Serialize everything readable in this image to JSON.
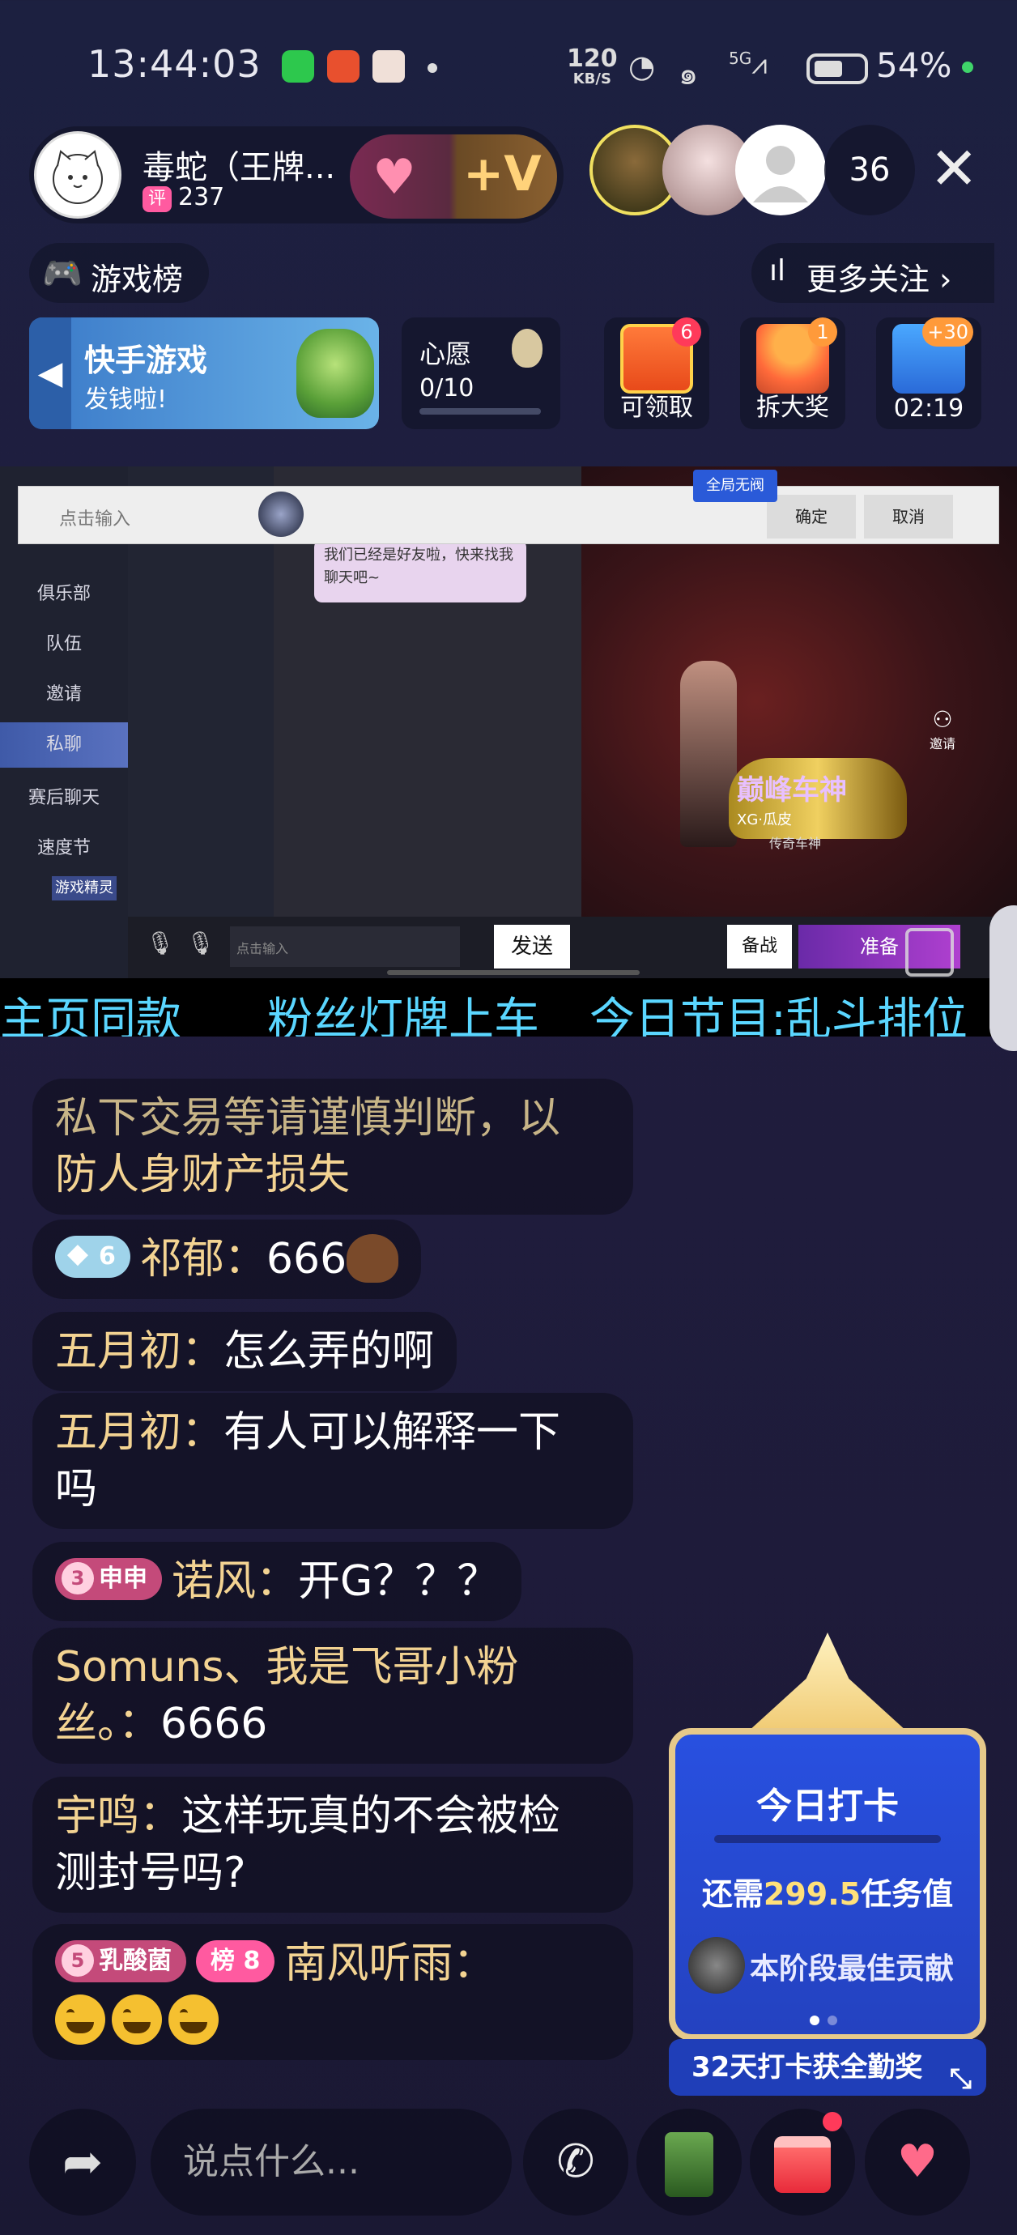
{
  "status_bar": {
    "time": "13:44:03",
    "net_speed_top": "120",
    "net_speed_bottom": "KB/S",
    "signal_label": "5G",
    "battery": "54%"
  },
  "host": {
    "name": "毒蛇（王牌...",
    "tag": "评",
    "score": "237",
    "viewer_count": "36"
  },
  "nav": {
    "game_rank": "游戏榜",
    "more_follow": "更多关注"
  },
  "activity": {
    "banner_title": "快手游戏",
    "banner_sub": "发钱啦!",
    "wish_label": "心愿",
    "wish_count": "0/10",
    "boxes": [
      {
        "label": "可领取",
        "badge": "6"
      },
      {
        "label": "拆大奖",
        "badge": "1"
      },
      {
        "label": "02:19",
        "badge": "+30"
      }
    ]
  },
  "stream": {
    "topbar_placeholder": "点击输入",
    "confirm": "确定",
    "cancel": "取消",
    "global_badge": "全局无阀",
    "sidebar": [
      "俱乐部",
      "队伍",
      "邀请",
      "私聊",
      "赛后聊天",
      "速度节"
    ],
    "sidebar_pill": "游戏精灵",
    "bubble": "我们已经是好友啦，快来找我聊天吧~",
    "game_title": "巅峰车神",
    "player": "XG·瓜皮",
    "player_sub": "传奇车神",
    "invite": "邀请",
    "chat_placeholder": "点击输入",
    "send": "发送",
    "prep": "备战",
    "ready": "准备"
  },
  "ticker": [
    "主页同款",
    "粉丝灯牌上车",
    "今日节目:乱斗排位"
  ],
  "chat": {
    "system": {
      "line1": "私下交易等请谨慎判断，以",
      "line2": "防人身财产损失"
    },
    "messages": [
      {
        "badge": "6",
        "user": "祁郁",
        "text": "666"
      },
      {
        "user": "五月初",
        "text": "怎么弄的啊"
      },
      {
        "user": "五月初",
        "text_l1": "有人可以解释一下",
        "text_l2": "吗"
      },
      {
        "badge_num": "3",
        "badge_name": "申申",
        "user": "诺风",
        "text": "开G？？？"
      },
      {
        "user_l1": "Somuns、我是飞哥小粉",
        "user_l2": "丝。",
        "text": "6666"
      },
      {
        "user": "宇鸣",
        "text_l1": "这样玩真的不会被检",
        "text_l2": "测封号吗?"
      },
      {
        "badge_num": "5",
        "badge_name": "乳酸菌",
        "rank": "榜 8",
        "user": "南风听雨"
      }
    ]
  },
  "checkin": {
    "title": "今日打卡",
    "need_prefix": "还需",
    "need_value": "299.5",
    "need_suffix": "任务值",
    "best": "本阶段最佳贡献",
    "footer": "32天打卡获全勤奖"
  },
  "bottom": {
    "input_placeholder": "说点什么..."
  },
  "colors": {
    "background": "#1e1b3a",
    "username": "#f3d392",
    "ticker": "#5ad6ff",
    "checkin": "#2850e0"
  }
}
